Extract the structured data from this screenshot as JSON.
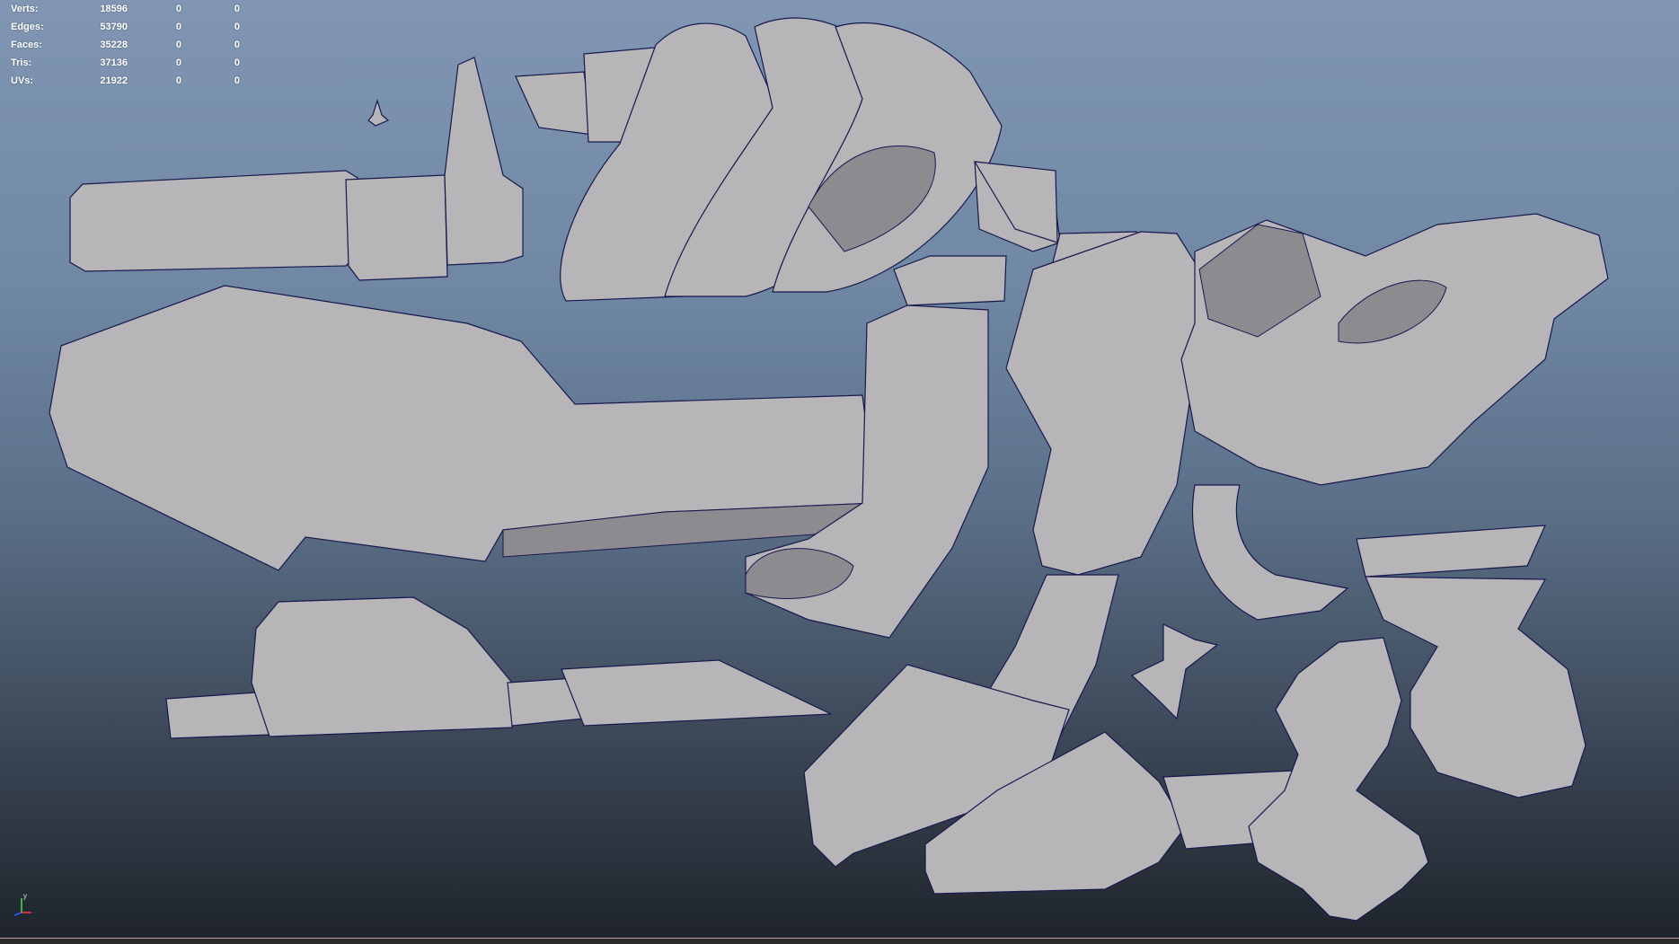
{
  "hud": {
    "rows": [
      {
        "label": "Verts:",
        "value": "18596",
        "sel": "0",
        "uvsel": "0"
      },
      {
        "label": "Edges:",
        "value": "53790",
        "sel": "0",
        "uvsel": "0"
      },
      {
        "label": "Faces:",
        "value": "35228",
        "sel": "0",
        "uvsel": "0"
      },
      {
        "label": "Tris:",
        "value": "37136",
        "sel": "0",
        "uvsel": "0"
      },
      {
        "label": "UVs:",
        "value": "21922",
        "sel": "0",
        "uvsel": "0"
      }
    ]
  },
  "axis": {
    "y_label": "y"
  },
  "colors": {
    "background_top": "#8096b2",
    "background_bottom": "#1e232a",
    "mesh_fill": "#b7b5b7",
    "wireframe": "#17184f"
  },
  "icons": {
    "axis": "xyz-axis-gizmo-icon"
  }
}
